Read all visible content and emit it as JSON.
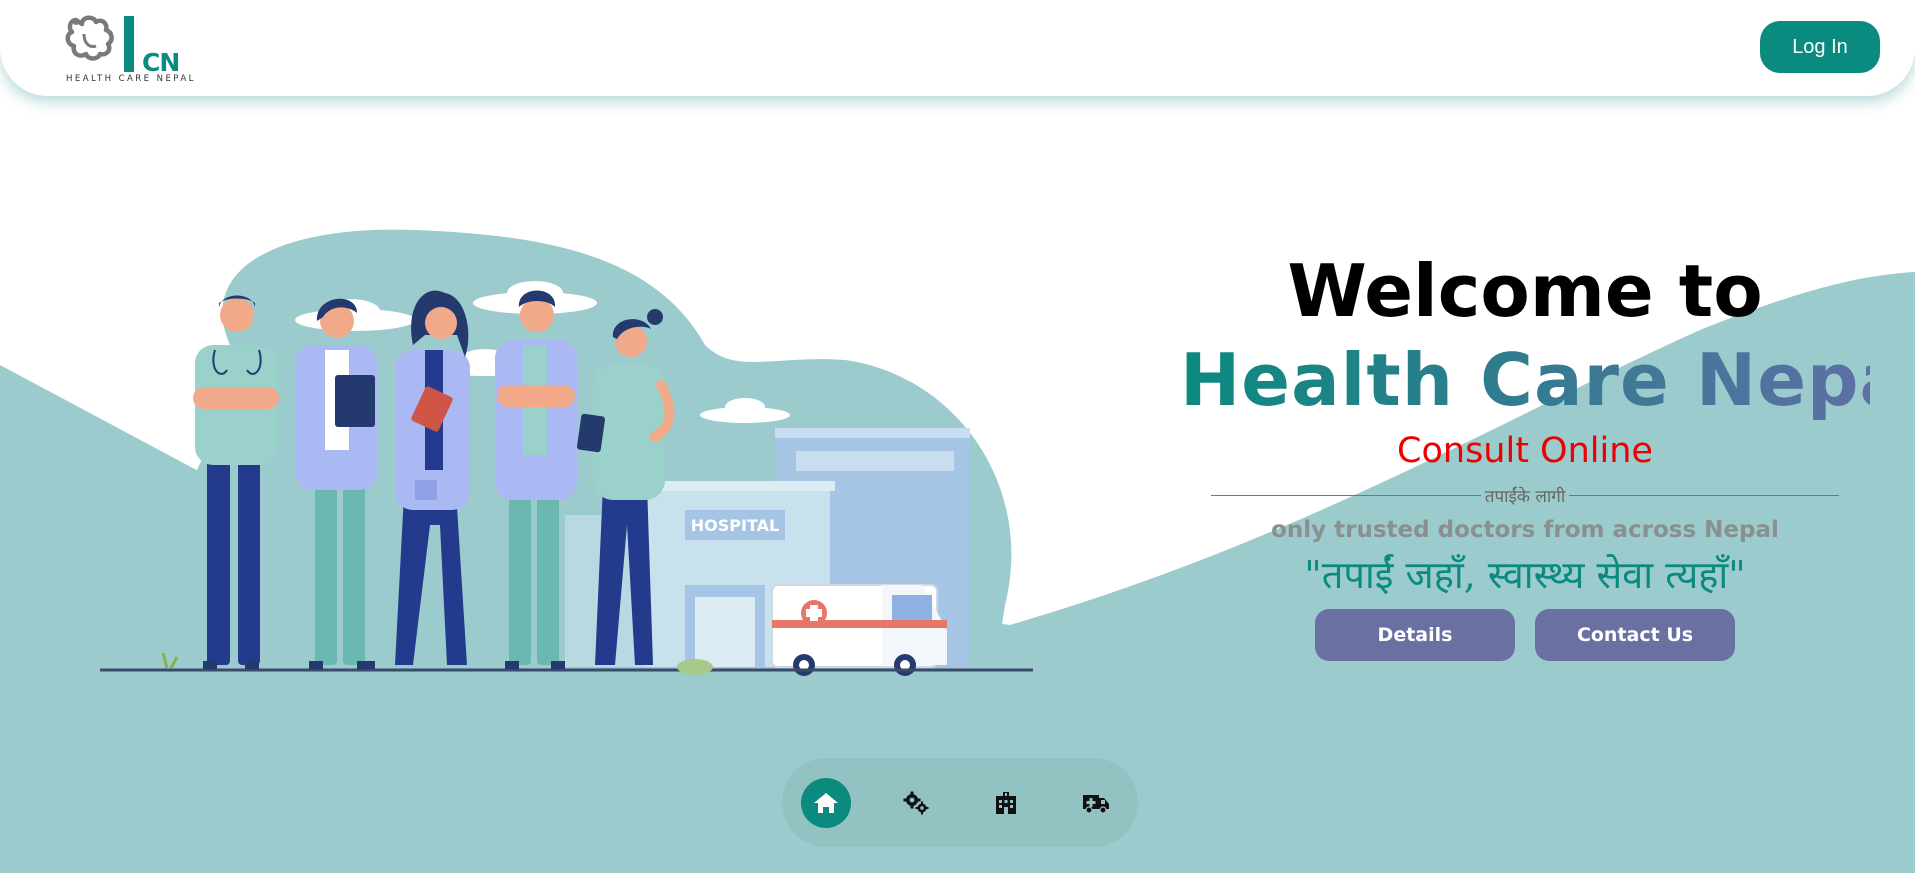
{
  "header": {
    "logo_abbr": "CN",
    "logo_tagline": "HEALTH CARE NEPAL",
    "login_label": "Log In"
  },
  "hero": {
    "welcome": "Welcome to",
    "brand": "Health Care Nepal",
    "consult": "Consult Online",
    "divider_text": "तपाईंके लागी",
    "trusted": "only trusted doctors from across Nepal",
    "quote": "\"तपाईं जहाँ, स्वास्थ्य सेवा त्यहाँ\"",
    "buttons": {
      "details": "Details",
      "contact": "Contact Us"
    }
  },
  "illustration": {
    "hospital_sign": "HOSPITAL"
  },
  "bottom_nav": {
    "items": [
      {
        "icon": "home-icon",
        "active": true
      },
      {
        "icon": "gears-icon",
        "active": false
      },
      {
        "icon": "building-icon",
        "active": false
      },
      {
        "icon": "ambulance-icon",
        "active": false
      }
    ]
  },
  "colors": {
    "brand_teal": "#0b8a7f",
    "wave": "#9bcbcc",
    "button_purple": "#6a70a2",
    "consult_red": "#ee0000"
  }
}
